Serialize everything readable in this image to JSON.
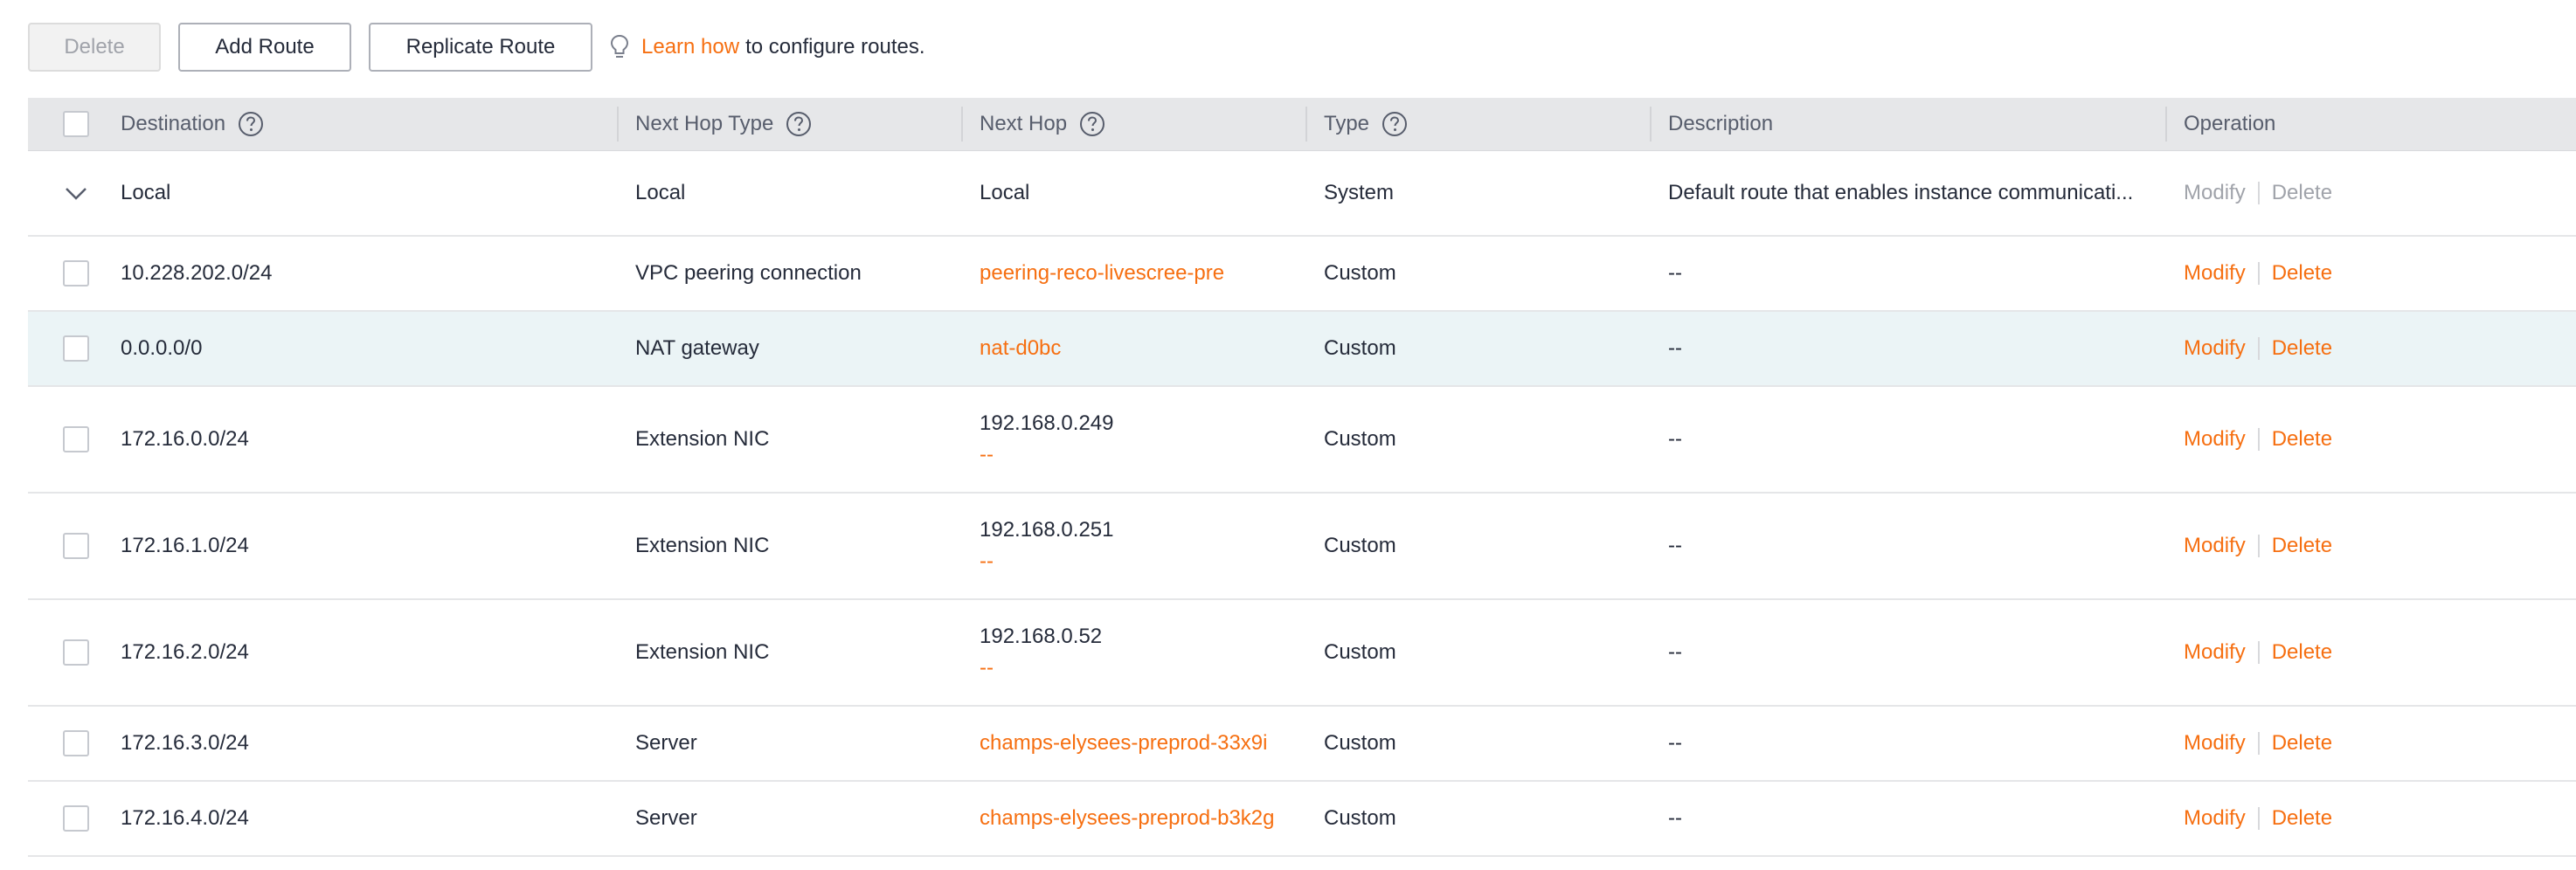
{
  "toolbar": {
    "delete_label": "Delete",
    "add_route_label": "Add Route",
    "replicate_route_label": "Replicate Route",
    "tip_link": "Learn how",
    "tip_text": "to configure routes."
  },
  "table": {
    "columns": {
      "destination": "Destination",
      "next_hop_type": "Next Hop Type",
      "next_hop": "Next Hop",
      "type": "Type",
      "description": "Description",
      "operation": "Operation"
    },
    "rows": [
      {
        "destination": "Local",
        "next_hop_type": "Local",
        "next_hop": "Local",
        "next_hop_sub": "",
        "type": "System",
        "description": "Default route that enables instance communicati...",
        "modify": "Modify",
        "delete": "Delete"
      },
      {
        "destination": "10.228.202.0/24",
        "next_hop_type": "VPC peering connection",
        "next_hop": "peering-reco-livescree-pre",
        "next_hop_sub": "",
        "type": "Custom",
        "description": "--",
        "modify": "Modify",
        "delete": "Delete"
      },
      {
        "destination": "0.0.0.0/0",
        "next_hop_type": "NAT gateway",
        "next_hop": "nat-d0bc",
        "next_hop_sub": "",
        "type": "Custom",
        "description": "--",
        "modify": "Modify",
        "delete": "Delete"
      },
      {
        "destination": "172.16.0.0/24",
        "next_hop_type": "Extension NIC",
        "next_hop": "192.168.0.249",
        "next_hop_sub": "--",
        "type": "Custom",
        "description": "--",
        "modify": "Modify",
        "delete": "Delete"
      },
      {
        "destination": "172.16.1.0/24",
        "next_hop_type": "Extension NIC",
        "next_hop": "192.168.0.251",
        "next_hop_sub": "--",
        "type": "Custom",
        "description": "--",
        "modify": "Modify",
        "delete": "Delete"
      },
      {
        "destination": "172.16.2.0/24",
        "next_hop_type": "Extension NIC",
        "next_hop": "192.168.0.52",
        "next_hop_sub": "--",
        "type": "Custom",
        "description": "--",
        "modify": "Modify",
        "delete": "Delete"
      },
      {
        "destination": "172.16.3.0/24",
        "next_hop_type": "Server",
        "next_hop": "champs-elysees-preprod-33x9i",
        "next_hop_sub": "",
        "type": "Custom",
        "description": "--",
        "modify": "Modify",
        "delete": "Delete"
      },
      {
        "destination": "172.16.4.0/24",
        "next_hop_type": "Server",
        "next_hop": "champs-elysees-preprod-b3k2g",
        "next_hop_sub": "",
        "type": "Custom",
        "description": "--",
        "modify": "Modify",
        "delete": "Delete"
      }
    ]
  },
  "colors": {
    "accent": "#f66f11",
    "header_bg": "#e6e7e9",
    "row_highlight": "#ebf4f6",
    "disabled_text": "#a0a3aa"
  },
  "icons": {
    "tip": "lightbulb-icon",
    "help": "question-circle-icon",
    "expand": "chevron-down-icon"
  }
}
